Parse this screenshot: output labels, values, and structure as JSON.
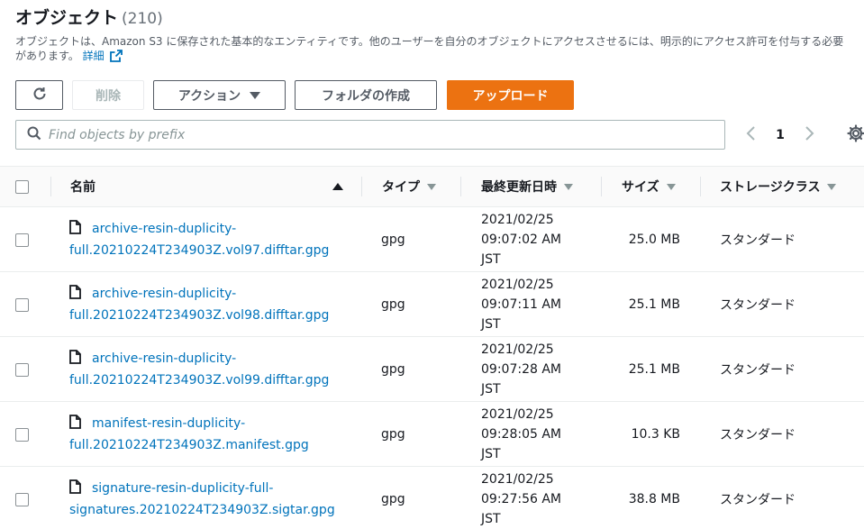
{
  "header": {
    "title": "オブジェクト",
    "count": "(210)",
    "description": "オブジェクトは、Amazon S3 に保存された基本的なエンティティです。他のユーザーを自分のオブジェクトにアクセスさせるには、明示的にアクセス許可を付与する必要があります。",
    "details_link": "詳細"
  },
  "toolbar": {
    "delete_label": "削除",
    "actions_label": "アクション",
    "create_folder_label": "フォルダの作成",
    "upload_label": "アップロード"
  },
  "search": {
    "placeholder": "Find objects by prefix",
    "value": ""
  },
  "pagination": {
    "current_page": "1"
  },
  "table": {
    "columns": {
      "name": "名前",
      "type": "タイプ",
      "last_modified": "最終更新日時",
      "size": "サイズ",
      "storage_class": "ストレージクラス"
    },
    "rows": [
      {
        "name_line1": "archive-resin-duplicity-",
        "name_line2": "full.20210224T234903Z.vol97.difftar.gpg",
        "type": "gpg",
        "date": "2021/02/25",
        "time": "09:07:02 AM",
        "tz": "JST",
        "size": "25.0 MB",
        "storage_class": "スタンダード"
      },
      {
        "name_line1": "archive-resin-duplicity-",
        "name_line2": "full.20210224T234903Z.vol98.difftar.gpg",
        "type": "gpg",
        "date": "2021/02/25",
        "time": "09:07:11 AM",
        "tz": "JST",
        "size": "25.1 MB",
        "storage_class": "スタンダード"
      },
      {
        "name_line1": "archive-resin-duplicity-",
        "name_line2": "full.20210224T234903Z.vol99.difftar.gpg",
        "type": "gpg",
        "date": "2021/02/25",
        "time": "09:07:28 AM",
        "tz": "JST",
        "size": "25.1 MB",
        "storage_class": "スタンダード"
      },
      {
        "name_line1": "manifest-resin-duplicity-",
        "name_line2": "full.20210224T234903Z.manifest.gpg",
        "type": "gpg",
        "date": "2021/02/25",
        "time": "09:28:05 AM",
        "tz": "JST",
        "size": "10.3 KB",
        "storage_class": "スタンダード"
      },
      {
        "name_line1": "signature-resin-duplicity-full-",
        "name_line2": "signatures.20210224T234903Z.sigtar.gpg",
        "type": "gpg",
        "date": "2021/02/25",
        "time": "09:27:56 AM",
        "tz": "JST",
        "size": "38.8 MB",
        "storage_class": "スタンダード"
      }
    ]
  },
  "colors": {
    "primary_button": "#ec7211",
    "link": "#0073bb",
    "text": "#16191f",
    "muted": "#545b64",
    "disabled": "#aab7b8"
  },
  "icons": {
    "refresh": "refresh-icon",
    "actions_caret": "caret-down-icon",
    "search": "search-icon",
    "external_link": "external-link-icon",
    "file": "file-icon",
    "settings": "gear-icon",
    "page_prev": "chevron-left-icon",
    "page_next": "chevron-right-icon"
  }
}
